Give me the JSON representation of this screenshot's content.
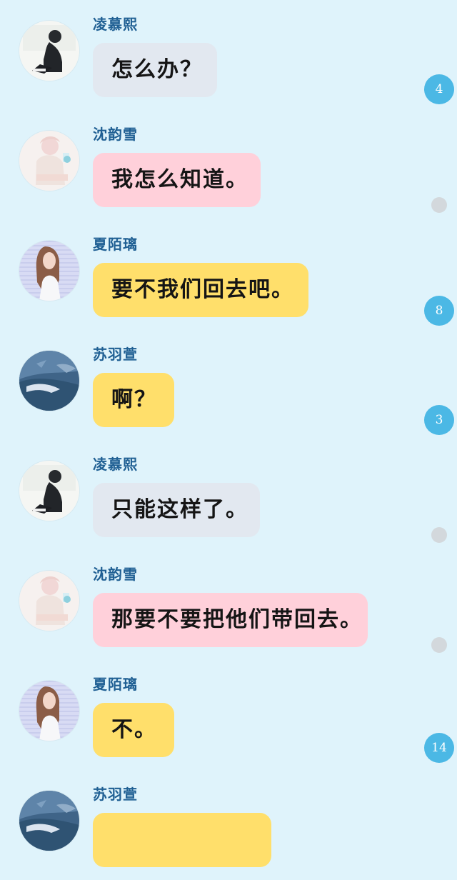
{
  "messages": [
    {
      "sender": "凌慕熙",
      "text": "怎么办？",
      "avatar": "avatar-girl-dark",
      "bubble_color": "#e2e8f0",
      "status": "badge",
      "status_value": "4"
    },
    {
      "sender": "沈韵雪",
      "text": "我怎么知道。",
      "avatar": "avatar-girl-pink",
      "bubble_color": "#ffd0da",
      "status": "read-dot",
      "status_value": ""
    },
    {
      "sender": "夏陌璃",
      "text": "要不我们回去吧。",
      "avatar": "avatar-girl-long-hair",
      "bubble_color": "#ffdf6b",
      "status": "badge",
      "status_value": "8"
    },
    {
      "sender": "苏羽萱",
      "text": "啊？",
      "avatar": "avatar-blue-scene",
      "bubble_color": "#ffdf6b",
      "status": "badge",
      "status_value": "3"
    },
    {
      "sender": "凌慕熙",
      "text": "只能这样了。",
      "avatar": "avatar-girl-dark",
      "bubble_color": "#e2e8f0",
      "status": "read-dot",
      "status_value": ""
    },
    {
      "sender": "沈韵雪",
      "text": "那要不要把他们带回去。",
      "avatar": "avatar-girl-pink",
      "bubble_color": "#ffd0da",
      "status": "read-dot",
      "status_value": ""
    },
    {
      "sender": "夏陌璃",
      "text": "不。",
      "avatar": "avatar-girl-long-hair",
      "bubble_color": "#ffdf6b",
      "status": "badge",
      "status_value": "14"
    },
    {
      "sender": "苏羽萱",
      "text": "",
      "avatar": "avatar-blue-scene",
      "bubble_color": "#ffdf6b",
      "status": "none",
      "status_value": ""
    }
  ]
}
